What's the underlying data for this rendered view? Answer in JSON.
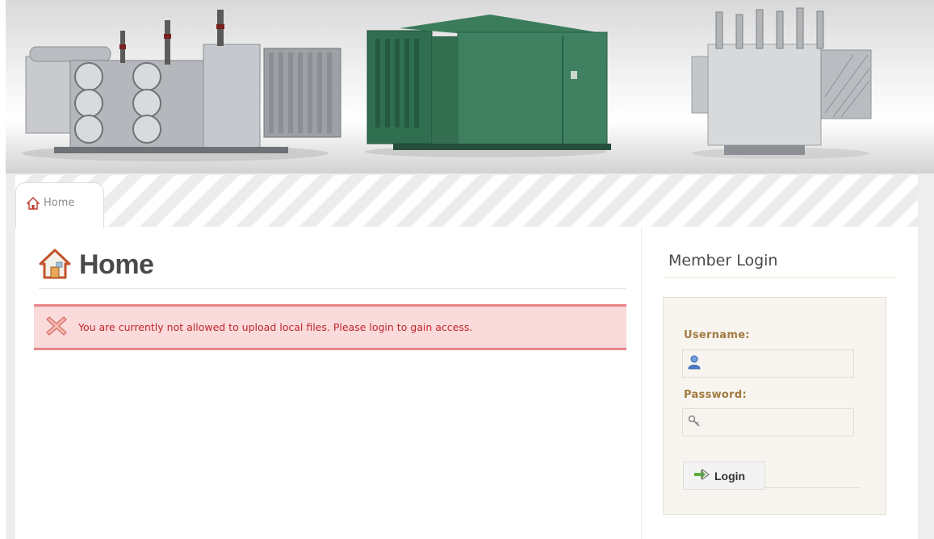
{
  "breadcrumb": {
    "home_label": "Home"
  },
  "page": {
    "title": "Home"
  },
  "error": {
    "message": "You are currently not allowed to upload local files. Please login to gain access."
  },
  "sidebar": {
    "heading": "Member Login",
    "username_label": "Username:",
    "password_label": "Password:",
    "username_value": "",
    "password_value": "",
    "login_button": "Login"
  },
  "icons": {
    "home": "home-icon",
    "error": "error-x-icon",
    "user": "user-icon",
    "key": "key-icon",
    "login": "login-arrow-icon"
  },
  "colors": {
    "error_text": "#c0272d",
    "error_bg": "#fadada",
    "label_text": "#a07a3f"
  }
}
